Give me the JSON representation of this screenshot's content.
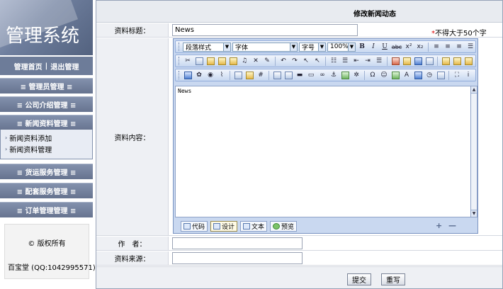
{
  "sidebar": {
    "logo_text": "管理系统",
    "toplinks": {
      "home": "管理首页",
      "sep": "|",
      "logout": "退出管理"
    },
    "menus": [
      {
        "label": "≡ 管理员管理 ≡"
      },
      {
        "label": "≡ 公司介绍管理 ≡"
      },
      {
        "label": "≡ 新闻资料管理 ≡"
      },
      {
        "label": "≡ 货运服务管理 ≡"
      },
      {
        "label": "≡ 配套服务管理 ≡"
      },
      {
        "label": "≡ 订单管理管理 ≡"
      }
    ],
    "submenu": [
      {
        "label": "新闻资料添加"
      },
      {
        "label": "新闻资料管理"
      }
    ],
    "copyright": "© 版权所有",
    "contact": "百宝堂  (QQ:1042995571)"
  },
  "main": {
    "page_title": "修改新闻动态",
    "title_label": "资料标题：",
    "title_value": "News",
    "title_note_star": "*",
    "title_note": "不得大于50个字",
    "content_label": "资料内容：",
    "author_label": "作　者：",
    "author_value": "",
    "source_label": "资料来源：",
    "source_value": "",
    "submit_label": "提交",
    "reset_label": "重写"
  },
  "editor": {
    "paragraph_style": "段落样式",
    "font": "字体",
    "font_size": "字号",
    "zoom": "100%",
    "content": "News",
    "modes": [
      {
        "label": "代码"
      },
      {
        "label": "设计"
      },
      {
        "label": "文本"
      },
      {
        "label": "预览"
      }
    ],
    "active_mode": "设计",
    "toolbar_glyphs": {
      "bold": "B",
      "italic": "I",
      "underline": "U",
      "strike": "abc",
      "superscript": "x²",
      "subscript": "x₂",
      "omega": "Ω",
      "smiley": "☺",
      "anchor": "⚓",
      "info": "i",
      "grow": "+",
      "shrink": "—"
    }
  },
  "colors": {
    "sidebar_header": "#6d7c99",
    "menu_bar": "#66738f",
    "panel_border": "#97a3b8",
    "label_bg": "#eef0f4",
    "note_star": "#dd0000"
  }
}
